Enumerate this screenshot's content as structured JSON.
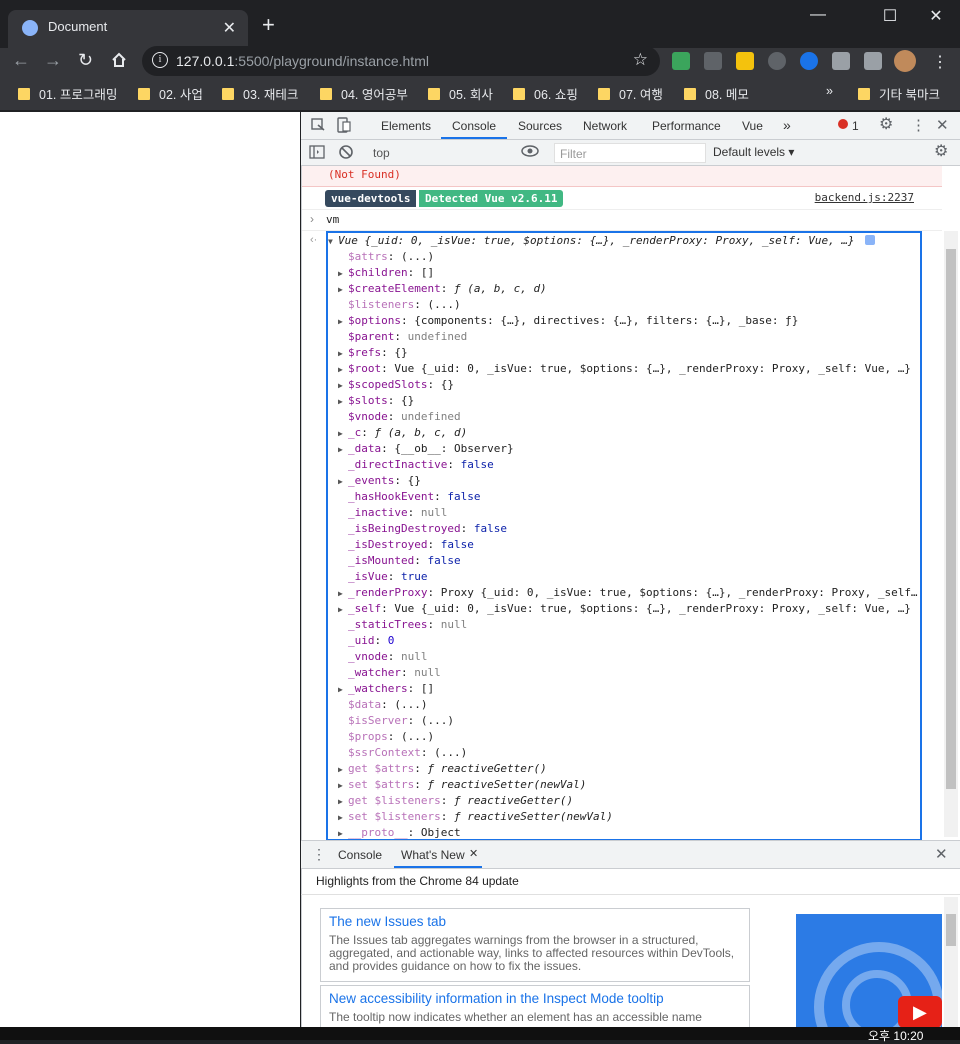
{
  "window": {
    "tab_title": "Document",
    "close_tab": "✕",
    "new_tab": "+",
    "minimize": "—",
    "maximize": "☐",
    "close": "✕"
  },
  "toolbar": {
    "url_host": "127.0.0.1",
    "url_rest": ":5500/playground/instance.html"
  },
  "bookmarks": [
    {
      "label": "01. 프로그래밍"
    },
    {
      "label": "02. 사업"
    },
    {
      "label": "03. 재테크"
    },
    {
      "label": "04. 영어공부"
    },
    {
      "label": "05. 회사"
    },
    {
      "label": "06. 쇼핑"
    },
    {
      "label": "07. 여행"
    },
    {
      "label": "08. 메모"
    }
  ],
  "bookmarks_overflow": "»",
  "other_bookmarks": "기타 북마크",
  "devtools": {
    "tabs": [
      "Elements",
      "Console",
      "Sources",
      "Network",
      "Performance",
      "Vue"
    ],
    "more_tabs": "»",
    "error_count": "1",
    "context": "top",
    "filter_placeholder": "Filter",
    "levels": "Default levels ▾"
  },
  "console": {
    "error_line": "(Not Found)",
    "vue_badge": "vue-devtools",
    "vue_detected": "Detected Vue v2.6.11",
    "vue_source": "backend.js:2237",
    "input": "vm",
    "header": "Vue {_uid: 0, _isVue: true, $options: {…}, _renderProxy: Proxy, _self: Vue, …}",
    "props": [
      {
        "tri": "",
        "key": "$attrs",
        "val": "(...)",
        "style": "kd",
        "vtype": ""
      },
      {
        "tri": "▶",
        "key": "$children",
        "val": "[]",
        "style": "k",
        "vtype": ""
      },
      {
        "tri": "▶",
        "key": "$createElement",
        "val": "ƒ (a, b, c, d)",
        "style": "k",
        "vtype": "fn"
      },
      {
        "tri": "",
        "key": "$listeners",
        "val": "(...)",
        "style": "kd",
        "vtype": ""
      },
      {
        "tri": "▶",
        "key": "$options",
        "val": "{components: {…}, directives: {…}, filters: {…}, _base: ƒ}",
        "style": "k",
        "vtype": ""
      },
      {
        "tri": "",
        "key": "$parent",
        "val": "undefined",
        "style": "k",
        "vtype": "null"
      },
      {
        "tri": "▶",
        "key": "$refs",
        "val": "{}",
        "style": "k",
        "vtype": ""
      },
      {
        "tri": "▶",
        "key": "$root",
        "val": "Vue {_uid: 0, _isVue: true, $options: {…}, _renderProxy: Proxy, _self: Vue, …}",
        "style": "k",
        "vtype": ""
      },
      {
        "tri": "▶",
        "key": "$scopedSlots",
        "val": "{}",
        "style": "k",
        "vtype": ""
      },
      {
        "tri": "▶",
        "key": "$slots",
        "val": "{}",
        "style": "k",
        "vtype": ""
      },
      {
        "tri": "",
        "key": "$vnode",
        "val": "undefined",
        "style": "k",
        "vtype": "null"
      },
      {
        "tri": "▶",
        "key": "_c",
        "val": "ƒ (a, b, c, d)",
        "style": "k",
        "vtype": "fn"
      },
      {
        "tri": "▶",
        "key": "_data",
        "val": "{__ob__: Observer}",
        "style": "k",
        "vtype": ""
      },
      {
        "tri": "",
        "key": "_directInactive",
        "val": "false",
        "style": "k",
        "vtype": "bool"
      },
      {
        "tri": "▶",
        "key": "_events",
        "val": "{}",
        "style": "k",
        "vtype": ""
      },
      {
        "tri": "",
        "key": "_hasHookEvent",
        "val": "false",
        "style": "k",
        "vtype": "bool"
      },
      {
        "tri": "",
        "key": "_inactive",
        "val": "null",
        "style": "k",
        "vtype": "null"
      },
      {
        "tri": "",
        "key": "_isBeingDestroyed",
        "val": "false",
        "style": "k",
        "vtype": "bool"
      },
      {
        "tri": "",
        "key": "_isDestroyed",
        "val": "false",
        "style": "k",
        "vtype": "bool"
      },
      {
        "tri": "",
        "key": "_isMounted",
        "val": "false",
        "style": "k",
        "vtype": "bool"
      },
      {
        "tri": "",
        "key": "_isVue",
        "val": "true",
        "style": "k",
        "vtype": "bool"
      },
      {
        "tri": "▶",
        "key": "_renderProxy",
        "val": "Proxy {_uid: 0, _isVue: true, $options: {…}, _renderProxy: Proxy, _self…",
        "style": "k",
        "vtype": ""
      },
      {
        "tri": "▶",
        "key": "_self",
        "val": "Vue {_uid: 0, _isVue: true, $options: {…}, _renderProxy: Proxy, _self: Vue, …}",
        "style": "k",
        "vtype": ""
      },
      {
        "tri": "",
        "key": "_staticTrees",
        "val": "null",
        "style": "k",
        "vtype": "null"
      },
      {
        "tri": "",
        "key": "_uid",
        "val": "0",
        "style": "k",
        "vtype": "num"
      },
      {
        "tri": "",
        "key": "_vnode",
        "val": "null",
        "style": "k",
        "vtype": "null"
      },
      {
        "tri": "",
        "key": "_watcher",
        "val": "null",
        "style": "k",
        "vtype": "null"
      },
      {
        "tri": "▶",
        "key": "_watchers",
        "val": "[]",
        "style": "k",
        "vtype": ""
      },
      {
        "tri": "",
        "key": "$data",
        "val": "(...)",
        "style": "kd",
        "vtype": ""
      },
      {
        "tri": "",
        "key": "$isServer",
        "val": "(...)",
        "style": "kd",
        "vtype": ""
      },
      {
        "tri": "",
        "key": "$props",
        "val": "(...)",
        "style": "kd",
        "vtype": ""
      },
      {
        "tri": "",
        "key": "$ssrContext",
        "val": "(...)",
        "style": "kd",
        "vtype": ""
      },
      {
        "tri": "▶",
        "key": "get $attrs",
        "val": "ƒ reactiveGetter()",
        "style": "kd",
        "vtype": "fn"
      },
      {
        "tri": "▶",
        "key": "set $attrs",
        "val": "ƒ reactiveSetter(newVal)",
        "style": "kd",
        "vtype": "fn"
      },
      {
        "tri": "▶",
        "key": "get $listeners",
        "val": "ƒ reactiveGetter()",
        "style": "kd",
        "vtype": "fn"
      },
      {
        "tri": "▶",
        "key": "set $listeners",
        "val": "ƒ reactiveSetter(newVal)",
        "style": "kd",
        "vtype": "fn"
      },
      {
        "tri": "▶",
        "key": "__proto__",
        "val": "Object",
        "style": "kd",
        "vtype": ""
      }
    ]
  },
  "drawer": {
    "tabs": [
      "Console",
      "What's New"
    ],
    "tab_close": "✕",
    "highlights": "Highlights from the Chrome 84 update",
    "cards": [
      {
        "title": "The new Issues tab",
        "desc": "The Issues tab aggregates warnings from the browser in a structured, aggregated, and actionable way, links to affected resources within DevTools, and provides guidance on how to fix the issues."
      },
      {
        "title": "New accessibility information in the Inspect Mode tooltip",
        "desc": "The tooltip now indicates whether an element has an accessible name"
      }
    ]
  },
  "taskbar": {
    "clock": "오후 10:20"
  }
}
